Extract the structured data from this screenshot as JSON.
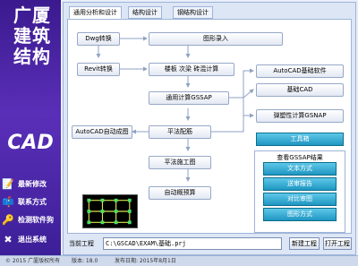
{
  "sidebar": {
    "logo_text": "广厦建筑结构",
    "logo_cad": "CAD",
    "links": [
      {
        "label": "最新修改",
        "icon": "notepad-icon"
      },
      {
        "label": "联系方式",
        "icon": "mailbox-icon"
      },
      {
        "label": "检测软件狗",
        "icon": "usb-key-icon"
      },
      {
        "label": "退出系统",
        "icon": "exit-icon"
      }
    ]
  },
  "tabs": [
    {
      "label": "通用分析和设计"
    },
    {
      "label": "结构设计"
    },
    {
      "label": "钢结构设计"
    }
  ],
  "flow": {
    "dwg": "Dwg转换",
    "revit": "Revit转换",
    "graphic_input": "图形录入",
    "slab_beam": "楼板 次梁 砖混计算",
    "gssap": "通用计算GSSAP",
    "autocad_base": "AutoCAD基础软件",
    "base_cad": "基础CAD",
    "snap": "弹塑性计算GSNAP",
    "autocad_auto": "AutoCAD自动成图",
    "rebar": "平法配筋",
    "construction": "平法施工图",
    "budget": "自动概预算",
    "toolbox": "工具箱"
  },
  "results": {
    "title": "查看GSSAP结果",
    "items": [
      "文本方式",
      "送审报告",
      "对比审图",
      "图形方式"
    ]
  },
  "project": {
    "label": "当前工程",
    "path": "C:\\GSCAD\\EXAM\\基础.prj",
    "new_button": "新建工程",
    "open_button": "打开工程"
  },
  "statusbar": {
    "copyright": "© 2015  广厦版权所有",
    "version": "版本: 18.0",
    "date": "发布日期: 2015年8月1日"
  },
  "colors": {
    "sidebar": "#4a27a6",
    "accent": "#1f96c2"
  }
}
